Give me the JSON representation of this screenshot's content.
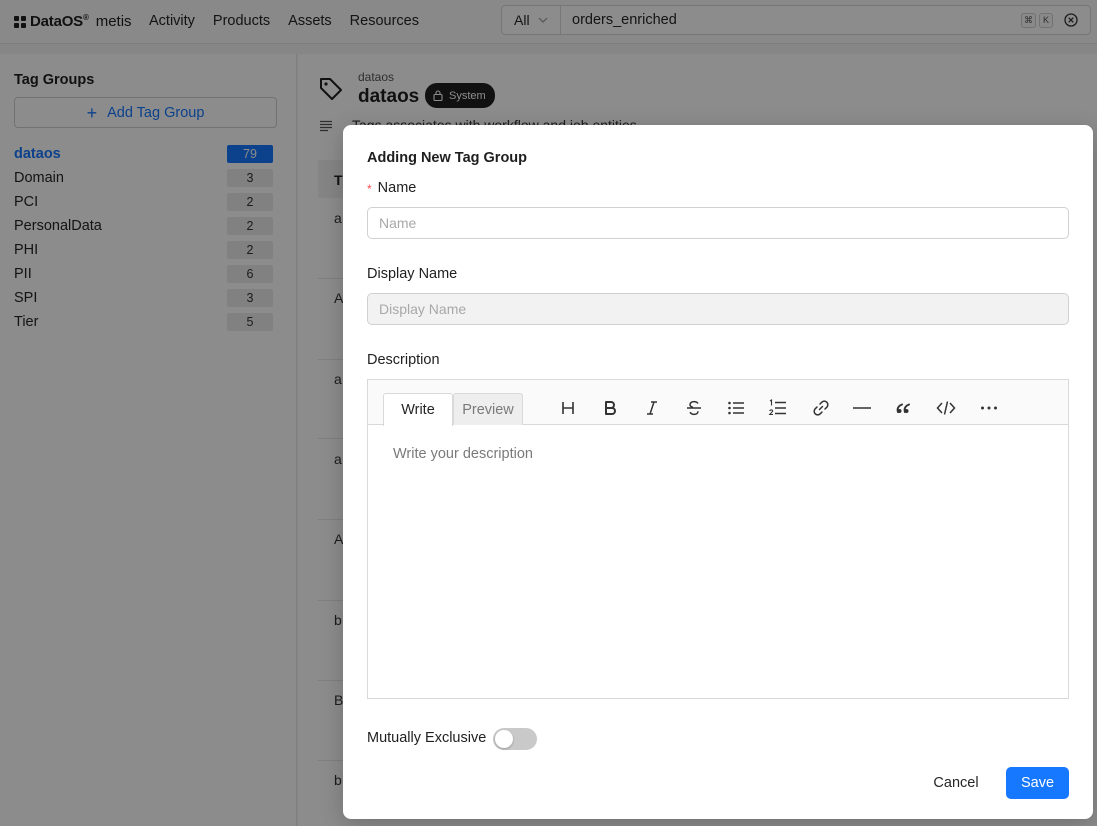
{
  "header": {
    "brand": "DataOS",
    "brand_mark": "®",
    "brand_sub": "metis",
    "nav": [
      "Activity",
      "Products",
      "Assets",
      "Resources"
    ],
    "search": {
      "scope": "All",
      "value": "orders_enriched",
      "shortcut_cmd": "⌘",
      "shortcut_key": "K"
    }
  },
  "sidebar": {
    "title": "Tag Groups",
    "add_button": "Add Tag Group",
    "groups": [
      {
        "name": "dataos",
        "count": "79",
        "active": true
      },
      {
        "name": "Domain",
        "count": "3"
      },
      {
        "name": "PCI",
        "count": "2"
      },
      {
        "name": "PersonalData",
        "count": "2"
      },
      {
        "name": "PHI",
        "count": "2"
      },
      {
        "name": "PII",
        "count": "6"
      },
      {
        "name": "SPI",
        "count": "3"
      },
      {
        "name": "Tier",
        "count": "5"
      }
    ]
  },
  "main": {
    "breadcrumb": "dataos",
    "title": "dataos",
    "badge": "System",
    "description": "Tags associates with workflow and job entities",
    "table_header_first": "T",
    "row_cells": [
      "a",
      "A",
      "a",
      "a",
      "A",
      "b",
      "B",
      "b"
    ]
  },
  "modal": {
    "title": "Adding New Tag Group",
    "name_label": "Name",
    "name_placeholder": "Name",
    "display_name_label": "Display Name",
    "display_name_placeholder": "Display Name",
    "description_label": "Description",
    "editor": {
      "tab_write": "Write",
      "tab_preview": "Preview",
      "placeholder": "Write your description",
      "toolbar_icons": [
        "heading-icon",
        "bold-icon",
        "italic-icon",
        "strikethrough-icon",
        "bullet-list-icon",
        "numbered-list-icon",
        "link-icon",
        "horizontal-rule-icon",
        "quote-icon",
        "code-icon",
        "more-icon"
      ]
    },
    "mutually_exclusive_label": "Mutually Exclusive",
    "mutually_exclusive": false,
    "cancel": "Cancel",
    "save": "Save"
  },
  "colors": {
    "accent": "#1677ff",
    "required": "#ff4d4f",
    "badge_bg": "#1f1f1f"
  }
}
